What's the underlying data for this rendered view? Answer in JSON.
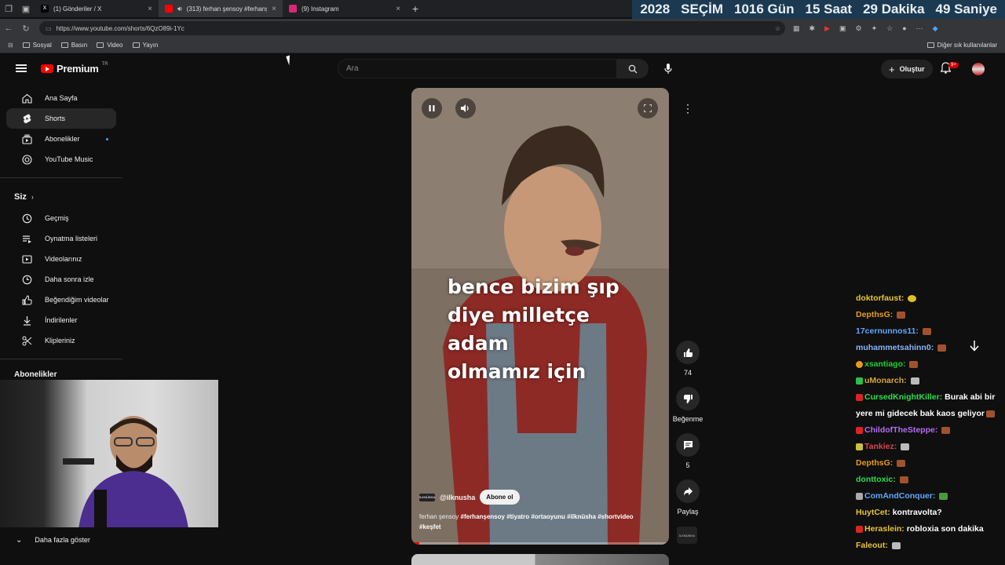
{
  "browser": {
    "tabs": [
      {
        "title": "(1) Gönderiler / X",
        "fav_color": "#000000",
        "fav_letter": "X"
      },
      {
        "title": "(313) ferhan şensoy #ferhanş",
        "fav_color": "#ff0000",
        "fav_letter": ""
      },
      {
        "title": "(9) Instagram",
        "fav_color": "#d62976",
        "fav_letter": ""
      }
    ],
    "url": "https://www.youtube.com/shorts/6QzO89i-1Yc",
    "bookmarks": [
      "Sosyal",
      "Basın",
      "Video",
      "Yayın"
    ],
    "other_bookmarks": "Diğer sık kullanılanlar"
  },
  "countdown": {
    "year": "2028",
    "label": "SEÇİM",
    "days": "1016 Gün",
    "hours": "15 Saat",
    "minutes": "29 Dakika",
    "seconds": "49 Saniye"
  },
  "header": {
    "logo_text": "Premium",
    "logo_region": "TR",
    "search_placeholder": "Ara",
    "create_label": "Oluştur",
    "notif_count": "9+"
  },
  "sidebar": {
    "main": [
      {
        "label": "Ana Sayfa",
        "icon": "home-icon"
      },
      {
        "label": "Shorts",
        "icon": "shorts-icon"
      },
      {
        "label": "Abonelikler",
        "icon": "subscriptions-icon"
      },
      {
        "label": "YouTube Music",
        "icon": "music-icon"
      }
    ],
    "you_title": "Siz",
    "you": [
      {
        "label": "Geçmiş",
        "icon": "history-icon"
      },
      {
        "label": "Oynatma listeleri",
        "icon": "playlist-icon"
      },
      {
        "label": "Videolarınız",
        "icon": "video-icon"
      },
      {
        "label": "Daha sonra izle",
        "icon": "clock-icon"
      },
      {
        "label": "Beğendiğim videolar",
        "icon": "like-icon"
      },
      {
        "label": "İndirilenler",
        "icon": "download-icon"
      },
      {
        "label": "Klipleriniz",
        "icon": "scissors-icon"
      }
    ],
    "subs_title": "Abonelikler",
    "show_more": "Daha fazla göster"
  },
  "short": {
    "overlay_lines": [
      "bence bizim şıp",
      "diye milletçe adam",
      "olmamız için"
    ],
    "channel_tag": "İLKNÜSHA",
    "channel": "@ilknusha",
    "subscribe": "Abone ol",
    "desc_plain": "ferhan şensoy",
    "desc_tags": "#ferhanşensoy #tiyatro #ortaoyunu #ilknüsha #shortvideo",
    "desc_tag2": "#keşfet",
    "progress": 0.03,
    "likes": "74",
    "dislike_label": "Beğenme",
    "comments": "5",
    "share_label": "Paylaş"
  },
  "chat": [
    {
      "user": "doktorfaust",
      "color": "#e8c43a",
      "text": "",
      "badge": "",
      "emote": "y"
    },
    {
      "user": "DepthsG",
      "color": "#e89b1a",
      "text": "",
      "badge": "",
      "emote": "b"
    },
    {
      "user": "17cernunnos11",
      "color": "#5fa8ff",
      "text": "",
      "badge": "",
      "emote": "b"
    },
    {
      "user": "muhammetsahinn0",
      "color": "#8ab4f8",
      "text": "",
      "badge": "",
      "emote": "b"
    },
    {
      "user": "xsantiago",
      "color": "#1ecf2f",
      "text": "",
      "badge": "o",
      "emote": "b"
    },
    {
      "user": "uMonarch",
      "color": "#d6a63c",
      "text": "",
      "badge": "gr",
      "emote": "s"
    },
    {
      "user": "CursedKnightKiller",
      "color": "#2bdc4f",
      "text": "Burak abi bir yere mi gidecek bak kaos geliyor",
      "badge": "r",
      "emote": "b"
    },
    {
      "user": "ChildofTheSteppe",
      "color": "#b46cf0",
      "text": "",
      "badge": "r",
      "emote": "b"
    },
    {
      "user": "Tankiez",
      "color": "#d8454a",
      "text": "",
      "badge": "yl",
      "emote": "s"
    },
    {
      "user": "DepthsG",
      "color": "#e89b1a",
      "text": "",
      "badge": "",
      "emote": "b"
    },
    {
      "user": "donttoxic",
      "color": "#2bdc4f",
      "text": "",
      "badge": "",
      "emote": "b"
    },
    {
      "user": "ComAndConquer",
      "color": "#5fa8ff",
      "text": "",
      "badge": "p",
      "emote": "g"
    },
    {
      "user": "HuytCet",
      "color": "#e8c43a",
      "text": "kontravolta?",
      "badge": "",
      "emote": ""
    },
    {
      "user": "Heraslein",
      "color": "#e8c43a",
      "text": "robloxia son dakika",
      "badge": "r",
      "emote": ""
    },
    {
      "user": "Faleout",
      "color": "#e8c43a",
      "text": "",
      "badge": "",
      "emote": "s"
    }
  ]
}
